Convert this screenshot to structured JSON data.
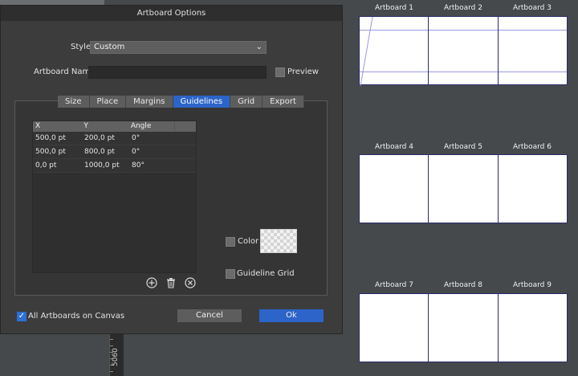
{
  "dialog": {
    "title": "Artboard Options",
    "style_label": "Style",
    "style_value": "Custom",
    "name_label": "Artboard Name",
    "name_value": "",
    "preview_label": "Preview",
    "tabs": [
      {
        "label": "Size"
      },
      {
        "label": "Place"
      },
      {
        "label": "Margins"
      },
      {
        "label": "Guidelines",
        "active": true
      },
      {
        "label": "Grid"
      },
      {
        "label": "Export"
      }
    ],
    "guides_table": {
      "headers": [
        "X",
        "Y",
        "Angle"
      ],
      "rows": [
        [
          "500,0 pt",
          "200,0 pt",
          "0°"
        ],
        [
          "500,0 pt",
          "800,0 pt",
          "0°"
        ],
        [
          "0,0 pt",
          "1000,0 pt",
          "80°"
        ]
      ]
    },
    "color_label": "Color",
    "guideline_grid_label": "Guideline Grid",
    "all_artboards_label": "All Artboards on Canvas",
    "cancel_label": "Cancel",
    "ok_label": "Ok",
    "icons": {
      "add": "plus-circle-icon",
      "delete": "trash-icon",
      "clear": "x-circle-icon"
    }
  },
  "canvas": {
    "ruler_value": "5060",
    "artboards": [
      "Artboard 1",
      "Artboard 2",
      "Artboard 3",
      "Artboard 4",
      "Artboard 5",
      "Artboard 6",
      "Artboard 7",
      "Artboard 8",
      "Artboard 9"
    ]
  },
  "colors": {
    "accent": "#2c64c9",
    "guide": "#9a9ae0",
    "artboard_border": "#2a2a6a"
  }
}
